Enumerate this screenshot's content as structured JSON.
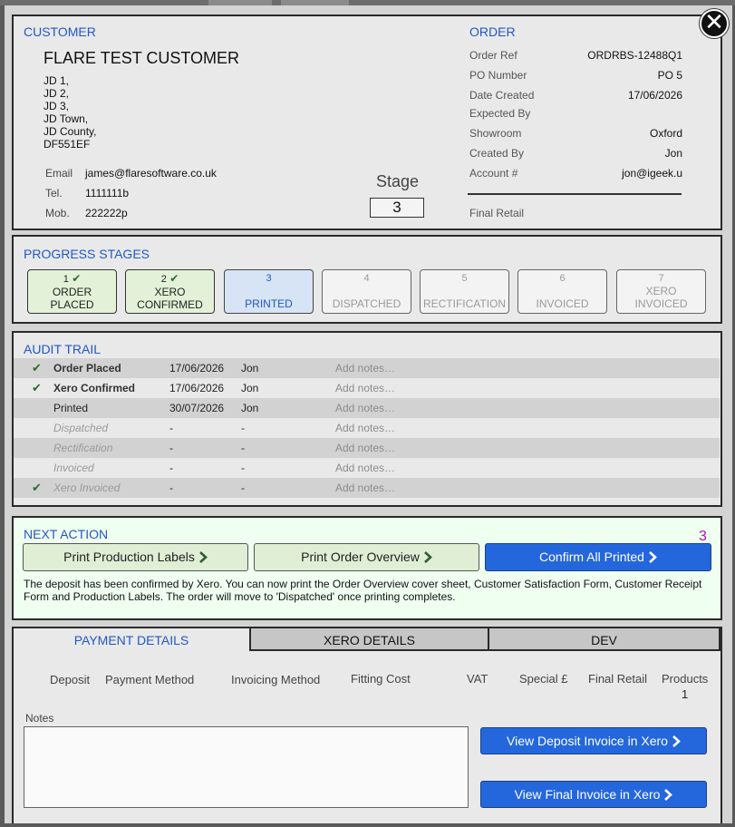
{
  "customer": {
    "title": "CUSTOMER",
    "name": "FLARE TEST CUSTOMER",
    "address": [
      "JD 1,",
      "JD 2,",
      "JD 3,",
      "JD Town,",
      "JD County,",
      "DF551EF"
    ],
    "email_label": "Email",
    "email": "james@flaresoftware.co.uk",
    "tel_label": "Tel.",
    "tel": "1111111b",
    "mob_label": "Mob.",
    "mob": "222222p",
    "stage_label": "Stage",
    "stage_value": "3"
  },
  "order": {
    "title": "ORDER",
    "rows": [
      {
        "label": "Order Ref",
        "value": "ORDRBS-12488Q1"
      },
      {
        "label": "PO Number",
        "value": "PO 5"
      },
      {
        "label": "Date Created",
        "value": "17/06/2026"
      },
      {
        "label": "Expected By",
        "value": ""
      },
      {
        "label": "Showroom",
        "value": "Oxford"
      },
      {
        "label": "Created By",
        "value": "Jon"
      },
      {
        "label": "Account #",
        "value": "jon@igeek.u"
      }
    ],
    "final_retail_label": "Final Retail"
  },
  "progress": {
    "title": "PROGRESS STAGES",
    "stages": [
      {
        "num": "1",
        "line1": "ORDER",
        "line2": "PLACED",
        "status": "done"
      },
      {
        "num": "2",
        "line1": "XERO",
        "line2": "CONFIRMED",
        "status": "done"
      },
      {
        "num": "3",
        "line1": "",
        "line2": "PRINTED",
        "status": "current"
      },
      {
        "num": "4",
        "line1": "",
        "line2": "DISPATCHED",
        "status": "pending"
      },
      {
        "num": "5",
        "line1": "",
        "line2": "RECTIFICATION",
        "status": "pending"
      },
      {
        "num": "6",
        "line1": "",
        "line2": "INVOICED",
        "status": "pending"
      },
      {
        "num": "7",
        "line1": "XERO",
        "line2": "INVOICED",
        "status": "pending"
      }
    ]
  },
  "audit": {
    "title": "AUDIT TRAIL",
    "rows": [
      {
        "check": true,
        "event": "Order Placed",
        "date": "17/06/2026",
        "by": "Jon",
        "notes": "Add notes…",
        "style": "bold"
      },
      {
        "check": true,
        "event": "Xero Confirmed",
        "date": "17/06/2026",
        "by": "Jon",
        "notes": "Add notes…",
        "style": "bold"
      },
      {
        "check": false,
        "event": "Printed",
        "date": "30/07/2026",
        "by": "Jon",
        "notes": "Add notes…",
        "style": "plain"
      },
      {
        "check": false,
        "event": "Dispatched",
        "date": "-",
        "by": "-",
        "notes": "Add notes…",
        "style": "ital"
      },
      {
        "check": false,
        "event": "Rectification",
        "date": "-",
        "by": "-",
        "notes": "Add notes…",
        "style": "ital"
      },
      {
        "check": false,
        "event": "Invoiced",
        "date": "-",
        "by": "-",
        "notes": "Add notes…",
        "style": "ital"
      },
      {
        "check": true,
        "event": "Xero Invoiced",
        "date": "-",
        "by": "-",
        "notes": "Add notes…",
        "style": "ital"
      }
    ]
  },
  "next_action": {
    "title": "NEXT ACTION",
    "count": "3",
    "btn_labels": "labels",
    "buttons": {
      "labels": "Print Production Labels",
      "overview": "Print Order Overview",
      "confirm": "Confirm All Printed"
    },
    "description": "The deposit has been confirmed by Xero. You can now print the Order Overview cover sheet, Customer Satisfaction Form, Customer Receipt Form and Production Labels. The order will move to 'Dispatched' once printing completes."
  },
  "tabs": {
    "payment": "PAYMENT DETAILS",
    "xero": "XERO DETAILS",
    "dev": "DEV"
  },
  "payment": {
    "columns": [
      "Deposit",
      "Payment Method",
      "Invoicing Method",
      "Fitting Cost",
      "VAT",
      "Special £",
      "Final Retail",
      "Products"
    ],
    "products_value": "1",
    "notes_label": "Notes",
    "view_deposit": "View Deposit Invoice in Xero",
    "view_final": "View Final Invoice in Xero"
  },
  "colors": {
    "accent": "#2157c9",
    "button_blue": "#2467dc",
    "done_green": "#e2f1d7",
    "count_purple": "#b012c0"
  }
}
